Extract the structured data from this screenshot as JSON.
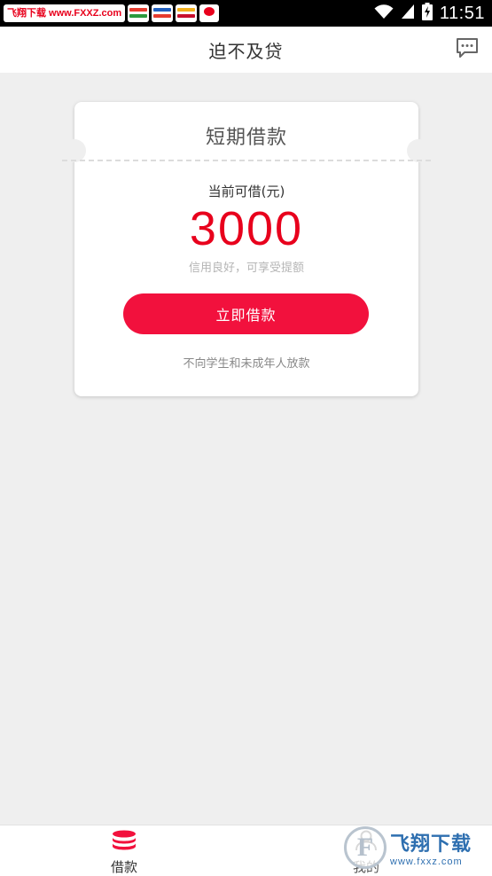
{
  "status_bar": {
    "watermark_text": "飞翔下载 www.FXXZ.com",
    "time": "11:51",
    "icons": [
      "wifi-icon",
      "signal-icon",
      "battery-charging-icon"
    ]
  },
  "header": {
    "title": "迫不及贷",
    "right_icon": "message-icon"
  },
  "loan_card": {
    "title": "短期借款",
    "amount_label": "当前可借(元)",
    "amount": "3000",
    "credit_note": "信用良好，可享受提额",
    "button_label": "立即借款",
    "disclaimer": "不向学生和未成年人放款"
  },
  "bottom_nav": {
    "items": [
      {
        "label": "借款",
        "icon": "coins-stack-icon",
        "active": true
      },
      {
        "label": "我的",
        "icon": "user-icon",
        "active": false
      }
    ]
  },
  "site_watermark": {
    "brand": "飞翔下载",
    "url": "www.fxxz.com"
  },
  "colors": {
    "accent": "#e8001c",
    "button": "#f2113d",
    "background": "#efefef"
  }
}
